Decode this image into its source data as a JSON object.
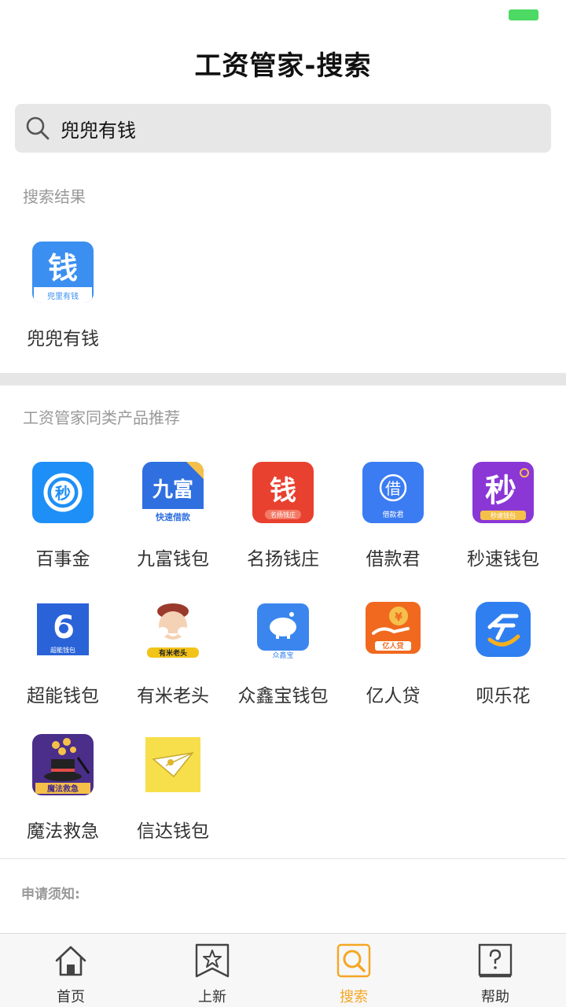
{
  "status_bar": {
    "battery_color": "#4cd964"
  },
  "header": {
    "title": "工资管家-搜索"
  },
  "search": {
    "value": "兜兜有钱",
    "icon": "search-icon"
  },
  "results": {
    "title": "搜索结果",
    "items": [
      {
        "label": "兜兜有钱",
        "icon": "qian-doulilyouqian-icon",
        "icon_text": "钱",
        "icon_caption": "兜里有钱"
      }
    ]
  },
  "recommend": {
    "title": "工资管家同类产品推荐",
    "items": [
      {
        "label": "百事金",
        "icon": "miao-circle-icon",
        "icon_text": "秒"
      },
      {
        "label": "九富钱包",
        "icon": "jiufu-icon",
        "icon_text": "九富",
        "icon_caption": "快速借款"
      },
      {
        "label": "名扬钱庄",
        "icon": "mingyang-icon",
        "icon_text": "钱",
        "icon_caption": "名扬钱庄"
      },
      {
        "label": "借款君",
        "icon": "jiekuanjun-icon",
        "icon_text": "借",
        "icon_caption": "借款君"
      },
      {
        "label": "秒速钱包",
        "icon": "miaosu-icon",
        "icon_text": "秒",
        "icon_caption": "秒速钱包"
      },
      {
        "label": "超能钱包",
        "icon": "chaoneng-icon",
        "icon_text": "6",
        "icon_caption": "超能钱包"
      },
      {
        "label": "有米老头",
        "icon": "youmi-oldman-icon",
        "icon_caption": "有米老头"
      },
      {
        "label": "众鑫宝钱包",
        "icon": "piggy-bank-icon",
        "icon_caption": "众鑫宝"
      },
      {
        "label": "亿人贷",
        "icon": "yirendai-icon",
        "icon_text": "¥",
        "icon_caption": "亿人贷"
      },
      {
        "label": "呗乐花",
        "icon": "beilehua-icon"
      },
      {
        "label": "魔法救急",
        "icon": "magic-hat-icon",
        "icon_caption": "魔法救急"
      },
      {
        "label": "信达钱包",
        "icon": "paper-plane-icon"
      }
    ]
  },
  "notice": {
    "label": "申请须知:"
  },
  "tabs": [
    {
      "label": "首页",
      "icon": "home-icon",
      "active": false
    },
    {
      "label": "上新",
      "icon": "bookmark-star-icon",
      "active": false
    },
    {
      "label": "搜索",
      "icon": "search-tab-icon",
      "active": true
    },
    {
      "label": "帮助",
      "icon": "help-icon",
      "active": false
    }
  ],
  "colors": {
    "accent": "#f5a623",
    "battery": "#4cd964",
    "divider": "#e6e6e6"
  }
}
